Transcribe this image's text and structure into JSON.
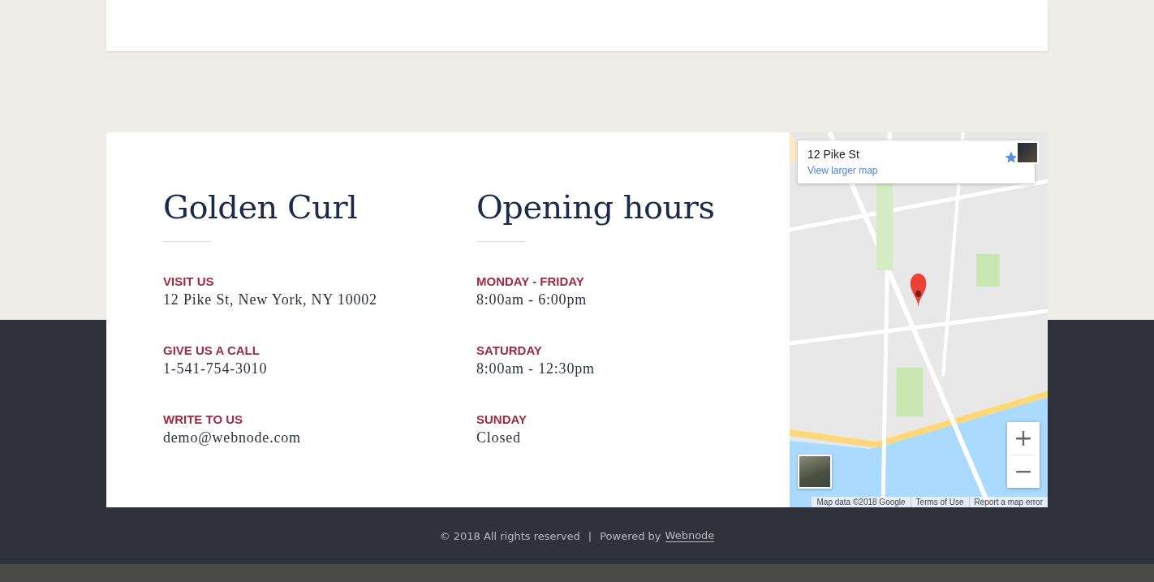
{
  "columns": [
    {
      "title": "Golden Curl",
      "items": [
        {
          "label": "VISIT US",
          "value": "12 Pike St, New York, NY 10002"
        },
        {
          "label": "GIVE US A CALL",
          "value": "1-541-754-3010"
        },
        {
          "label": "WRITE TO US",
          "value": "demo@webnode.com"
        }
      ]
    },
    {
      "title": "Opening hours",
      "items": [
        {
          "label": "MONDAY - FRIDAY",
          "value": "8:00am - 6:00pm"
        },
        {
          "label": "SATURDAY",
          "value": "8:00am - 12:30pm"
        },
        {
          "label": "SUNDAY",
          "value": "Closed"
        }
      ]
    }
  ],
  "map": {
    "kind": "picture",
    "place": "12 Pike St",
    "link": "View larger map",
    "zoom_in": "+",
    "zoom_out": "−",
    "attribution": [
      "Map data ©2018 Google",
      "Terms of Use",
      "Report a map error"
    ]
  },
  "footer": {
    "copyright": "© 2018 All rights reserved",
    "separator": "|",
    "powered_by": "Powered by",
    "link": "Webnode"
  }
}
